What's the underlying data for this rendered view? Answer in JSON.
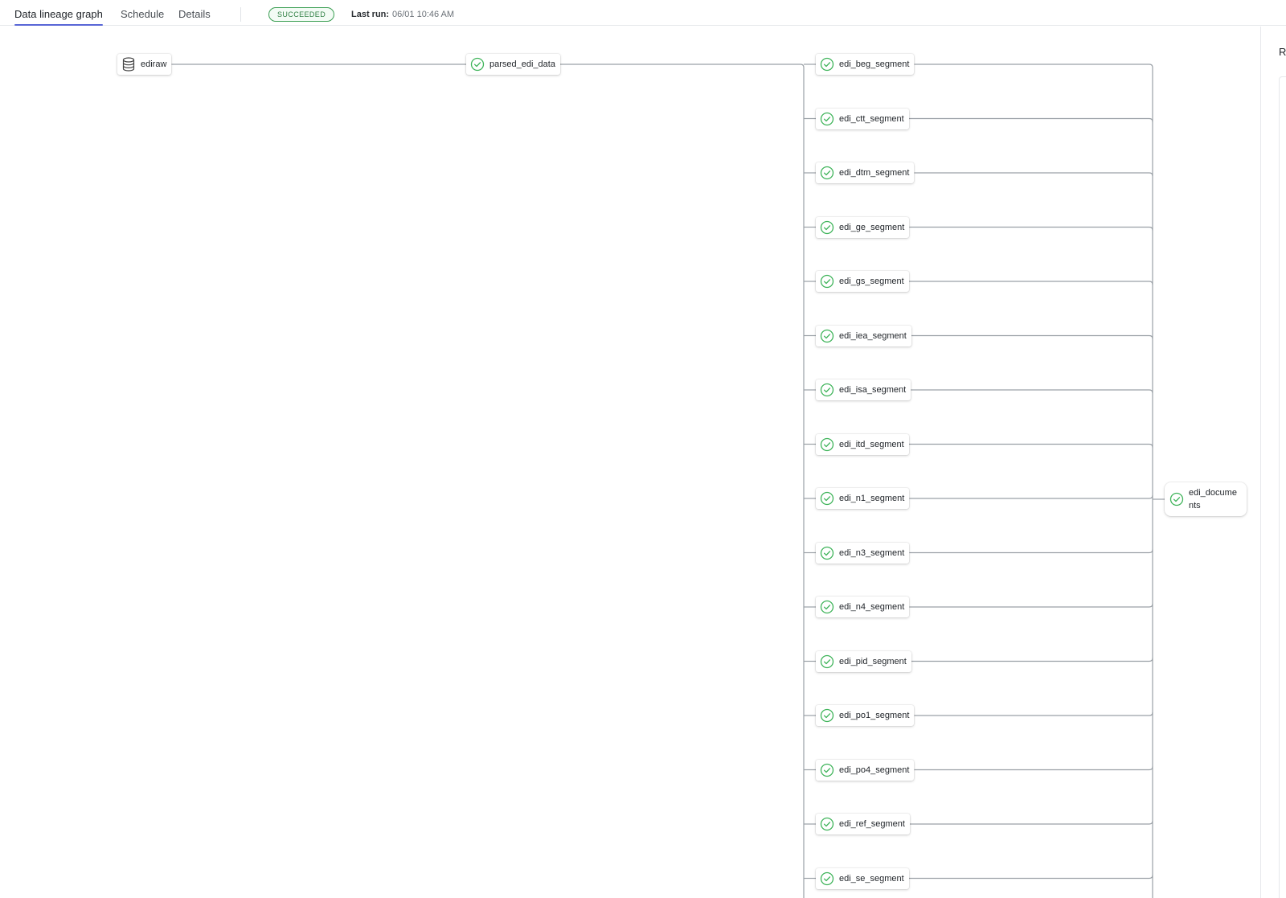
{
  "tabs": [
    {
      "label": "Data lineage graph",
      "active": true
    },
    {
      "label": "Schedule",
      "active": false
    },
    {
      "label": "Details",
      "active": false
    }
  ],
  "status": {
    "label": "SUCCEEDED",
    "color": "#3a9e52"
  },
  "last_run": {
    "label": "Last run:",
    "value": "06/01 10:46 AM"
  },
  "graph": {
    "source": {
      "label": "ediraw",
      "icon": "database-icon"
    },
    "parsed": {
      "label": "parsed_edi_data",
      "icon": "check-circle-icon"
    },
    "segments": [
      "edi_beg_segment",
      "edi_ctt_segment",
      "edi_dtm_segment",
      "edi_ge_segment",
      "edi_gs_segment",
      "edi_iea_segment",
      "edi_isa_segment",
      "edi_itd_segment",
      "edi_n1_segment",
      "edi_n3_segment",
      "edi_n4_segment",
      "edi_pid_segment",
      "edi_po1_segment",
      "edi_po4_segment",
      "edi_ref_segment",
      "edi_se_segment"
    ],
    "output": {
      "label": "edi_documents",
      "icon": "check-circle-icon"
    },
    "success_color": "#3fb45a",
    "edge_color": "#9aa0a6"
  },
  "right_panel": {
    "title": "R"
  }
}
